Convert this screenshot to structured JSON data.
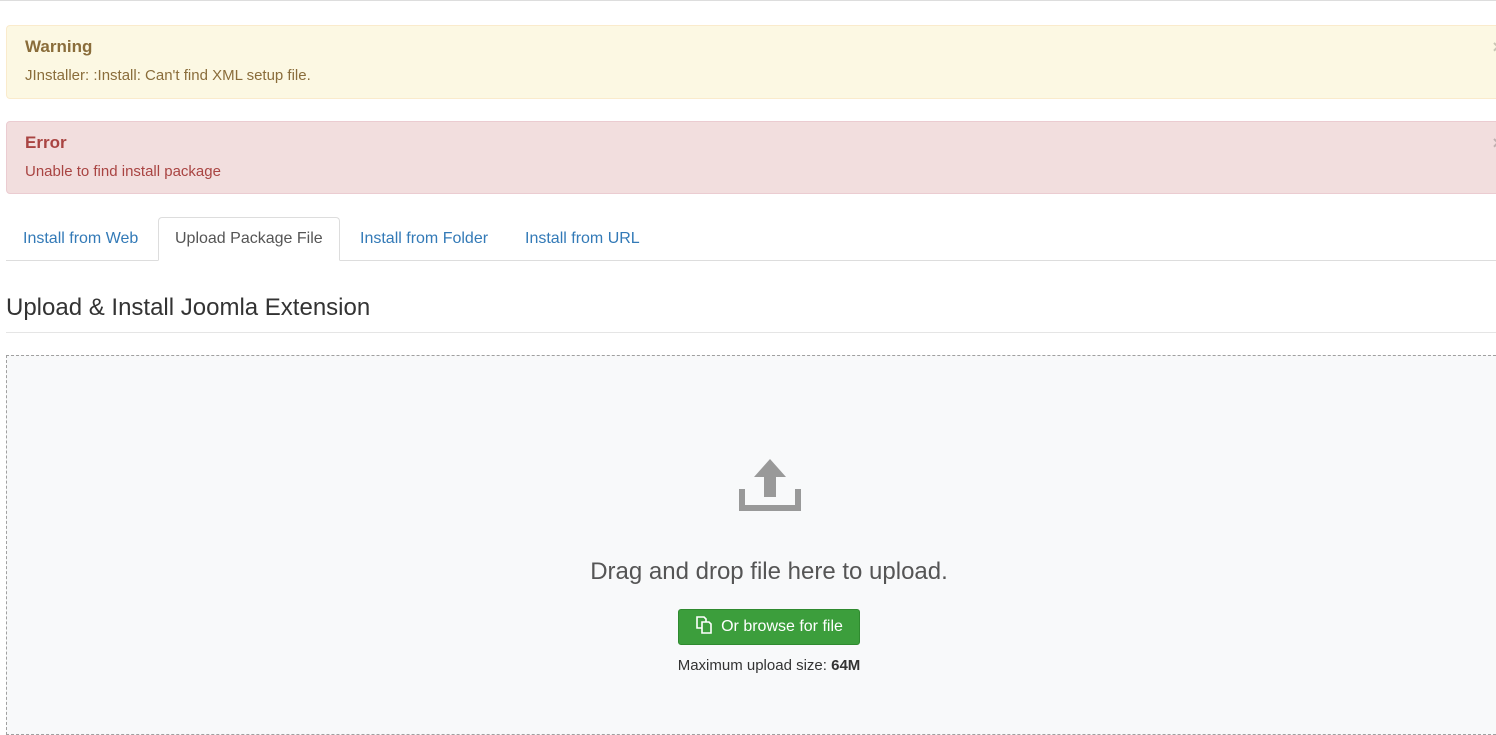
{
  "alerts": {
    "warning": {
      "heading": "Warning",
      "message": "JInstaller: :Install: Can't find XML setup file.",
      "close": "×",
      "color": "#8a6d3b",
      "background": "#fcf8e3"
    },
    "error": {
      "heading": "Error",
      "message": "Unable to find install package",
      "close": "×",
      "color": "#a94442",
      "background": "#f2dede"
    }
  },
  "tabs": [
    {
      "label": "Install from Web",
      "active": false
    },
    {
      "label": "Upload Package File",
      "active": true
    },
    {
      "label": "Install from Folder",
      "active": false
    },
    {
      "label": "Install from URL",
      "active": false
    }
  ],
  "main": {
    "title": "Upload & Install Joomla Extension",
    "dropzone": {
      "icon": "upload-icon",
      "text": "Drag and drop file here to upload.",
      "browse_label": "Or browse for file",
      "browse_icon": "copy-icon",
      "max_size_label": "Maximum upload size:",
      "max_size_value": "64M"
    }
  },
  "colors": {
    "link": "#337ab7",
    "button": "#3c9e3c",
    "icon": "#999999"
  }
}
